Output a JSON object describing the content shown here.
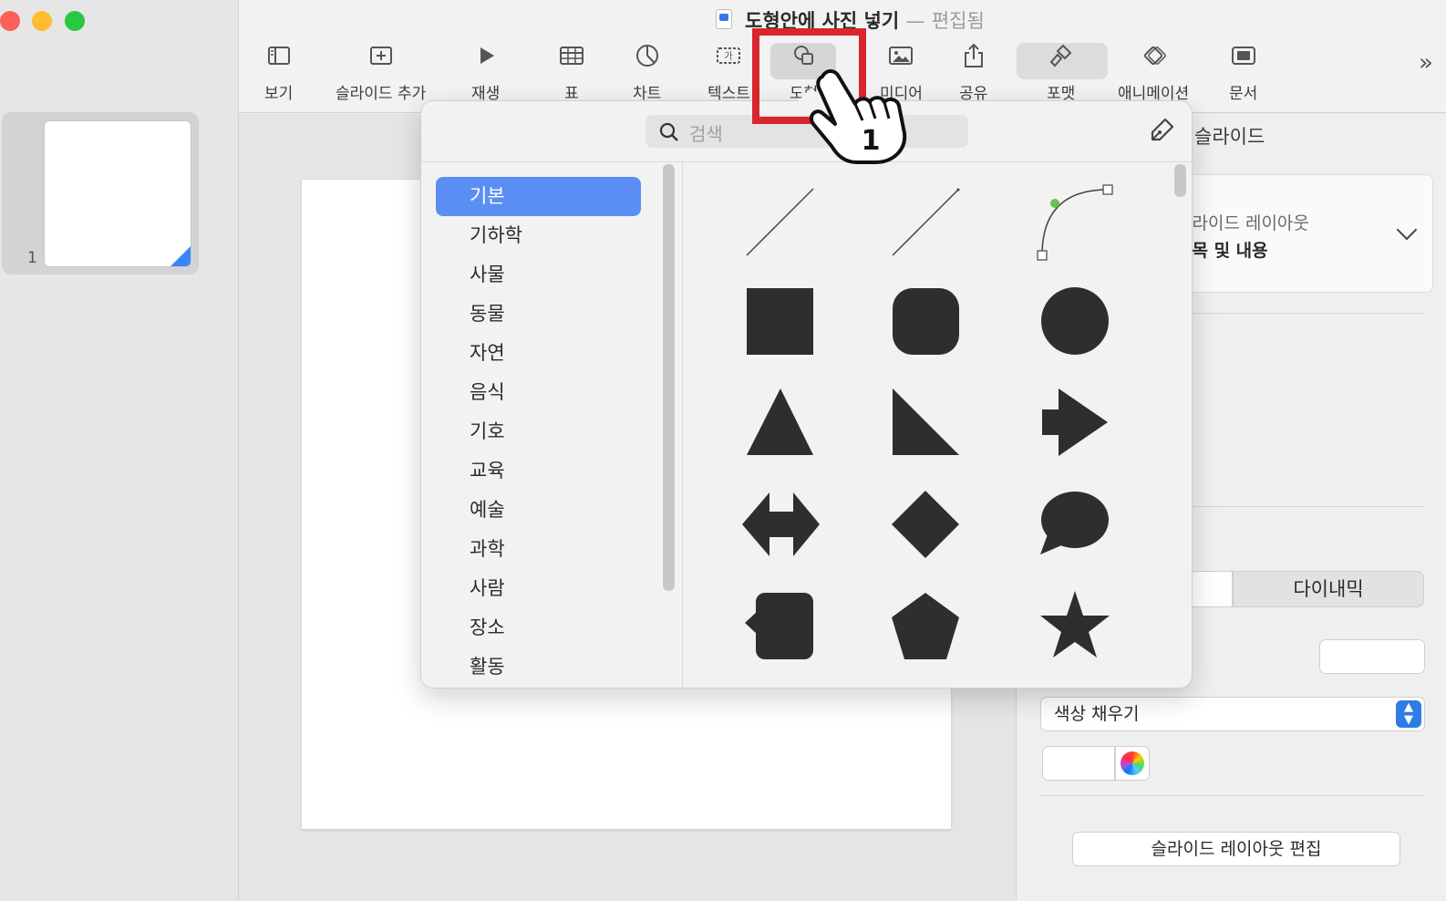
{
  "window": {
    "title": "도형안에 사진 넣기",
    "title_separator": "—",
    "title_status": "편집됨"
  },
  "toolbar": {
    "items": [
      {
        "label": "보기",
        "icon": "sidebar-view-icon"
      },
      {
        "label": "슬라이드 추가",
        "icon": "add-slide-icon"
      },
      {
        "label": "재생",
        "icon": "play-icon"
      },
      {
        "label": "표",
        "icon": "table-icon"
      },
      {
        "label": "차트",
        "icon": "chart-icon"
      },
      {
        "label": "텍스트",
        "icon": "text-box-icon"
      },
      {
        "label": "도형",
        "icon": "shape-icon"
      },
      {
        "label": "미디어",
        "icon": "media-icon"
      },
      {
        "label": "공유",
        "icon": "share-icon"
      },
      {
        "label": "포맷",
        "icon": "format-brush-icon"
      },
      {
        "label": "애니메이션",
        "icon": "animate-icon"
      },
      {
        "label": "문서",
        "icon": "document-icon"
      }
    ],
    "overflow_glyph": "»"
  },
  "navigator": {
    "slides": [
      {
        "number": "1"
      }
    ]
  },
  "shape_popover": {
    "search_placeholder": "검색",
    "categories": [
      {
        "label": "기본",
        "selected": true
      },
      {
        "label": "기하학"
      },
      {
        "label": "사물"
      },
      {
        "label": "동물"
      },
      {
        "label": "자연"
      },
      {
        "label": "음식"
      },
      {
        "label": "기호"
      },
      {
        "label": "교육"
      },
      {
        "label": "예술"
      },
      {
        "label": "과학"
      },
      {
        "label": "사람"
      },
      {
        "label": "장소"
      },
      {
        "label": "활동"
      }
    ],
    "shapes": [
      "line",
      "line-with-end",
      "curve",
      "square",
      "rounded-square",
      "circle",
      "triangle",
      "right-triangle",
      "arrow-right",
      "double-arrow",
      "diamond",
      "speech-bubble",
      "callout-square",
      "pentagon",
      "star"
    ]
  },
  "inspector": {
    "tab_label": "슬라이드",
    "layout_label": "슬라이드 레이아웃",
    "layout_value": "제목 및 내용",
    "segment_right": "다이내믹",
    "fill_select": "색상 채우기",
    "edit_layout_button": "슬라이드 레이아웃 편집"
  },
  "annotation": {
    "step_number": "1",
    "highlight_color": "#d9262c"
  },
  "colors": {
    "accent": "#5b8ef5",
    "shape_fill": "#2e2e2e"
  }
}
